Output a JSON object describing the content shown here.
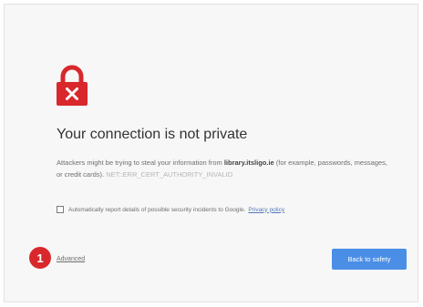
{
  "page": {
    "title": "Your connection is not private",
    "body_prefix": "Attackers might be trying to steal your information from ",
    "host": "library.itsligo.ie",
    "body_suffix": " (for example, passwords, messages, or credit cards).",
    "error_code": "NET::ERR_CERT_AUTHORITY_INVALID",
    "report_label": "Automatically report details of possible security incidents to Google.",
    "privacy_link": "Privacy policy",
    "advanced_link": "Advanced",
    "back_button": "Back to safety",
    "badge_number": "1"
  },
  "icons": {
    "lock": "lock-error-icon"
  },
  "colors": {
    "lock_red": "#d8282c",
    "button_blue": "#4a8ee6",
    "badge_red": "#d8282c",
    "page_background": "#f7f7f7"
  }
}
